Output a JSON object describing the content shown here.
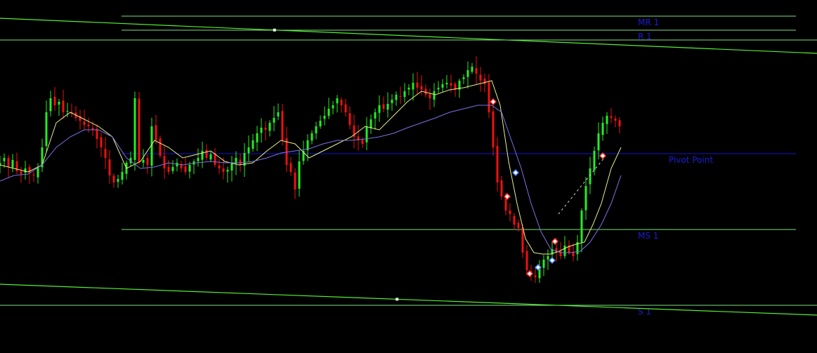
{
  "colors": {
    "background": "#000000",
    "level_line": "#7ee07e",
    "pivot_line": "#1414d8",
    "level_label": "#1c1cd6",
    "trendline": "#55ee33",
    "candle_up": "#22ee22",
    "candle_down": "#ee1111",
    "ma_fast": "#e6f08a",
    "ma_slow": "#7a72e6",
    "dotted_trend": "#d8d8d8",
    "signal_buy": "#3a78ff",
    "signal_sell": "#ff3030"
  },
  "chart_data": {
    "type": "candlestick",
    "title": "",
    "xlabel": "",
    "ylabel": "",
    "ylim": [
      0,
      503
    ],
    "grid": false,
    "levels": [
      {
        "label": "MR 1",
        "value": 23
      },
      {
        "label": "R 1",
        "value": 43
      },
      {
        "label": "",
        "value": 57
      },
      {
        "label": "Pivot Point",
        "value": 219
      },
      {
        "label": "MS 1",
        "value": 327
      },
      {
        "label": "S 1",
        "value": 435
      }
    ],
    "trendlines": [
      {
        "from": [
          0,
          26
        ],
        "to": [
          1163,
          76
        ],
        "anchor_index": 0.336
      },
      {
        "from": [
          0,
          405
        ],
        "to": [
          1163,
          449
        ],
        "anchor_index": 0.486
      }
    ],
    "series": [
      {
        "name": "",
        "role": "close",
        "x": [
          0,
          6,
          12,
          18,
          24,
          30,
          36,
          42,
          48,
          54,
          60,
          66,
          72,
          78,
          84,
          90,
          96,
          102,
          108,
          114,
          120,
          126,
          132,
          138,
          144,
          150,
          156,
          162,
          168,
          174,
          180,
          186,
          192,
          198,
          204,
          210,
          216,
          222,
          228,
          234,
          240,
          246,
          252,
          258,
          264,
          270,
          276,
          282,
          288,
          294,
          300,
          306,
          312,
          318,
          324,
          330,
          336,
          342,
          348,
          354,
          360,
          366,
          372,
          378,
          384,
          390,
          396,
          402,
          408,
          414,
          420,
          426,
          432,
          438,
          444,
          450,
          456,
          462,
          468,
          474,
          480,
          486,
          492,
          498,
          504,
          510,
          516,
          522,
          528,
          534,
          540,
          546,
          552,
          558,
          564,
          570,
          576,
          582,
          588,
          594,
          600,
          606,
          612,
          618,
          624,
          630,
          636,
          642,
          648,
          654,
          660,
          666,
          672,
          678,
          684,
          690,
          696,
          702,
          708,
          714,
          720,
          726,
          732,
          738,
          744,
          750,
          756,
          762,
          768,
          774,
          780,
          786,
          792,
          798,
          804,
          810,
          816,
          822,
          828,
          834,
          840,
          846,
          852,
          858,
          864,
          870,
          876,
          882
        ],
        "values": [
          232,
          225,
          238,
          228,
          244,
          248,
          240,
          246,
          250,
          238,
          210,
          160,
          140,
          150,
          145,
          160,
          158,
          162,
          168,
          172,
          178,
          180,
          185,
          198,
          210,
          225,
          250,
          260,
          255,
          245,
          232,
          225,
          140,
          230,
          228,
          235,
          180,
          200,
          222,
          240,
          245,
          238,
          232,
          240,
          245,
          235,
          230,
          225,
          215,
          225,
          220,
          235,
          240,
          245,
          242,
          232,
          225,
          235,
          218,
          210,
          200,
          190,
          182,
          185,
          175,
          168,
          160,
          200,
          235,
          245,
          270,
          230,
          215,
          200,
          190,
          180,
          172,
          165,
          155,
          150,
          140,
          150,
          160,
          178,
          195,
          200,
          205,
          180,
          170,
          160,
          150,
          155,
          148,
          142,
          135,
          138,
          130,
          125,
          118,
          125,
          128,
          135,
          140,
          130,
          125,
          120,
          118,
          122,
          128,
          115,
          110,
          100,
          95,
          105,
          115,
          120,
          160,
          210,
          260,
          280,
          300,
          305,
          320,
          325,
          360,
          385,
          390,
          395,
          380,
          370,
          365,
          355,
          360,
          365,
          350,
          360,
          365,
          345,
          300,
          265,
          240,
          215,
          190,
          175,
          165,
          168,
          172,
          180
        ]
      },
      {
        "name": "",
        "role": "ma_fast",
        "x": [
          0,
          20,
          40,
          60,
          80,
          100,
          120,
          140,
          160,
          180,
          200,
          220,
          240,
          260,
          280,
          300,
          320,
          340,
          360,
          380,
          400,
          420,
          440,
          460,
          480,
          500,
          520,
          540,
          560,
          580,
          600,
          620,
          640,
          660,
          680,
          700,
          712,
          724,
          736,
          748,
          760,
          772,
          784,
          796,
          808,
          820,
          832,
          844,
          856,
          870,
          884
        ],
        "values": [
          235,
          240,
          245,
          235,
          175,
          160,
          170,
          180,
          195,
          240,
          230,
          200,
          210,
          225,
          220,
          215,
          230,
          235,
          232,
          215,
          200,
          205,
          225,
          215,
          205,
          195,
          180,
          185,
          165,
          145,
          130,
          135,
          128,
          125,
          120,
          115,
          150,
          230,
          290,
          340,
          360,
          362,
          362,
          358,
          352,
          348,
          345,
          320,
          290,
          240,
          210
        ]
      },
      {
        "name": "",
        "role": "ma_slow",
        "x": [
          0,
          20,
          40,
          60,
          80,
          100,
          120,
          140,
          160,
          180,
          200,
          220,
          240,
          260,
          280,
          300,
          320,
          340,
          360,
          380,
          400,
          420,
          440,
          460,
          480,
          500,
          520,
          540,
          560,
          580,
          600,
          620,
          640,
          660,
          680,
          700,
          714,
          728,
          742,
          756,
          770,
          784,
          798,
          812,
          826,
          840,
          856,
          870,
          884
        ],
        "values": [
          258,
          250,
          248,
          235,
          210,
          195,
          185,
          185,
          195,
          225,
          240,
          238,
          232,
          235,
          232,
          230,
          232,
          232,
          230,
          225,
          218,
          215,
          212,
          205,
          200,
          200,
          198,
          195,
          190,
          182,
          175,
          168,
          160,
          155,
          150,
          150,
          160,
          200,
          240,
          290,
          330,
          355,
          360,
          360,
          358,
          345,
          320,
          290,
          250
        ]
      },
      {
        "name": "",
        "role": "dotted_trend",
        "x": [
          795,
          860
        ],
        "values": [
          305,
          225
        ]
      }
    ],
    "signals": [
      {
        "type": "sell",
        "x": 702,
        "y": 145
      },
      {
        "type": "buy",
        "x": 734,
        "y": 246
      },
      {
        "type": "sell",
        "x": 722,
        "y": 280
      },
      {
        "type": "sell",
        "x": 790,
        "y": 344
      },
      {
        "type": "buy",
        "x": 766,
        "y": 381
      },
      {
        "type": "buy",
        "x": 786,
        "y": 371
      },
      {
        "type": "sell",
        "x": 754,
        "y": 390
      },
      {
        "type": "sell",
        "x": 858,
        "y": 222
      }
    ]
  }
}
